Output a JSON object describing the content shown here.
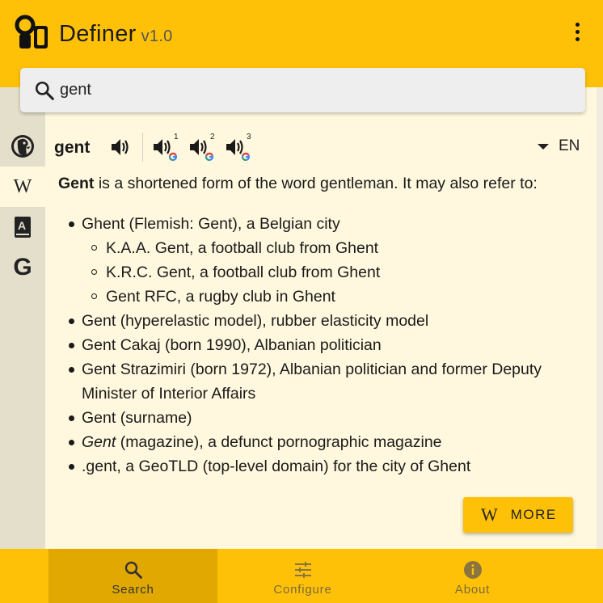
{
  "app": {
    "title": "Definer",
    "version": "v1.0"
  },
  "search": {
    "value": "gent",
    "placeholder": ""
  },
  "sidebar": {
    "items": [
      {
        "name": "duckduckgo",
        "icon": "duck-icon"
      },
      {
        "name": "wikipedia",
        "icon": "wikipedia-icon",
        "glyph": "W"
      },
      {
        "name": "dictionary",
        "icon": "dictionary-icon",
        "glyph": "A"
      },
      {
        "name": "google",
        "icon": "google-icon",
        "glyph": "G"
      }
    ],
    "active_index": 1
  },
  "entry": {
    "word": "gent",
    "pronunciation_badges": [
      "1",
      "2",
      "3"
    ],
    "language": "EN"
  },
  "definition": {
    "intro_bold": "Gent",
    "intro_rest": " is a shortened form of the word gentleman. It may also refer to:",
    "items": [
      {
        "text": "Ghent (Flemish: Gent), a Belgian city"
      },
      {
        "text": "Gent (hyperelastic model), rubber elasticity model"
      },
      {
        "text": "Gent Cakaj (born 1990), Albanian politician"
      },
      {
        "text": "Gent Strazimiri (born 1972), Albanian politician and former Deputy Minister of Interior Affairs"
      },
      {
        "text": "Gent (surname)"
      },
      {
        "italic": "Gent",
        "text": " (magazine), a defunct pornographic magazine"
      },
      {
        "text": ".gent, a GeoTLD (top-level domain) for the city of Ghent"
      }
    ],
    "sub_items": [
      "K.A.A. Gent, a football club from Ghent",
      "K.R.C. Gent, a football club from Ghent",
      "Gent RFC, a rugby club in Ghent"
    ]
  },
  "more_button": {
    "glyph": "W",
    "label": "MORE"
  },
  "bottom_nav": {
    "items": [
      {
        "label": "Search",
        "icon": "search-icon"
      },
      {
        "label": "Configure",
        "icon": "sliders-icon"
      },
      {
        "label": "About",
        "icon": "info-icon"
      }
    ],
    "active_index": 0
  },
  "colors": {
    "accent": "#ffc107",
    "accent_dark": "#e0a800",
    "content_bg": "#fff8de",
    "sidebar_bg": "#e4dfcb",
    "google_blue": "#4285f4",
    "google_red": "#ea4335",
    "google_yellow": "#fbbc05",
    "google_green": "#34a853"
  }
}
